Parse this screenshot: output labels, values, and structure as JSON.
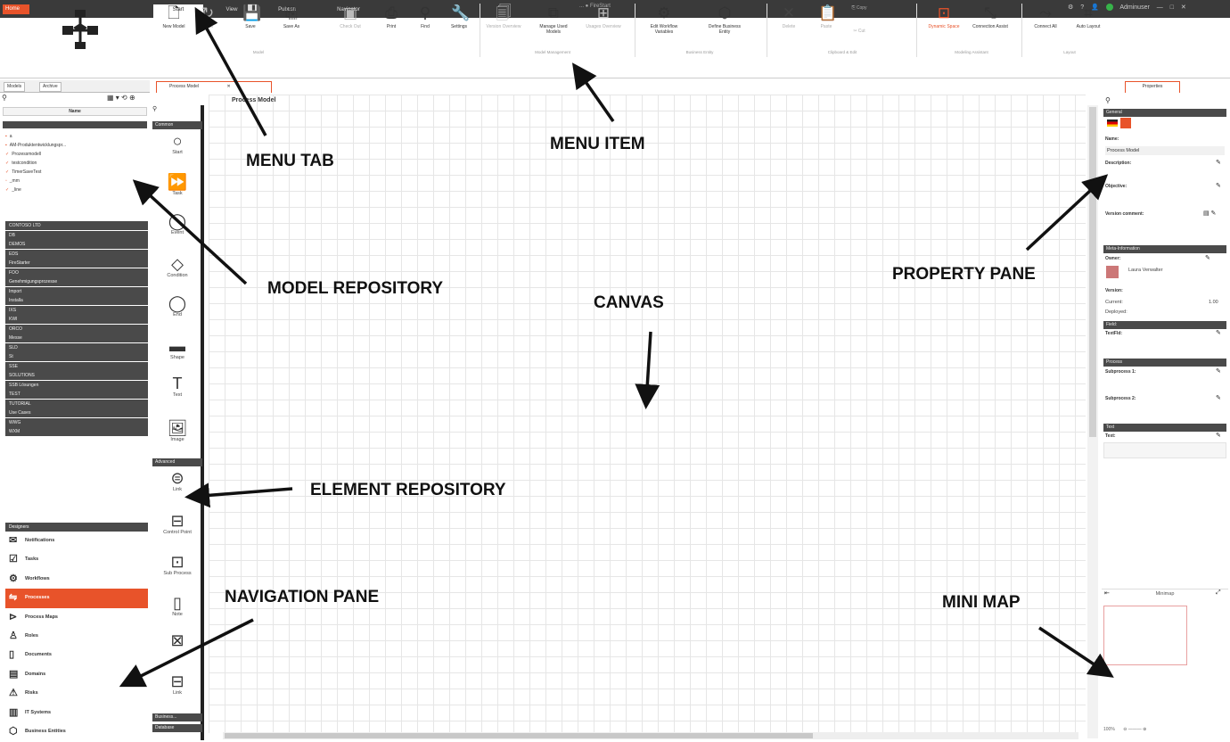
{
  "titlebar": {
    "app_button": "Home",
    "tabs": [
      "Start",
      "View",
      "Publish",
      "Navigator"
    ],
    "window_title": "... ● FireStart",
    "user": "Adminuser"
  },
  "ribbon": {
    "items": [
      {
        "label": "New Model",
        "icon": "new-document-icon"
      },
      {
        "label": "Redo",
        "icon": "redo-icon"
      },
      {
        "label": "Save",
        "icon": "save-icon"
      },
      {
        "label": "Save As",
        "icon": "save-as-icon"
      },
      {
        "label": "Check Out",
        "icon": "check-out-icon"
      },
      {
        "label": "Print",
        "icon": "print-icon"
      },
      {
        "label": "Find",
        "icon": "search-icon"
      },
      {
        "label": "Settings",
        "icon": "wrench-icon"
      },
      {
        "label": "Version Overview",
        "icon": "version-icon"
      },
      {
        "label": "Manage Used Models",
        "icon": "models-icon"
      },
      {
        "label": "Usages Overview",
        "icon": "usages-icon"
      },
      {
        "label": "Edit Workflow Variables",
        "icon": "variables-icon"
      },
      {
        "label": "Define Business Entity",
        "icon": "cube-icon"
      },
      {
        "label": "Delete",
        "icon": "delete-icon"
      },
      {
        "label": "Paste",
        "icon": "paste-icon"
      },
      {
        "label": "Copy",
        "icon": "copy-icon"
      },
      {
        "label": "Cut",
        "icon": "cut-icon"
      },
      {
        "label": "Dynamic Space",
        "icon": "dynamic-space-icon"
      },
      {
        "label": "Connection Assist",
        "icon": "connection-assist-icon"
      },
      {
        "label": "Connect All",
        "icon": "connect-all-icon"
      },
      {
        "label": "Auto Layout",
        "icon": "auto-layout-icon"
      }
    ],
    "groups": [
      "Model",
      "Model Management",
      "Business Entity",
      "Clipboard & Edit",
      "Modeling Assistant",
      "Layout"
    ]
  },
  "left_panel": {
    "tabs": [
      "Models",
      "Archive"
    ],
    "tree_header": "Name",
    "tree_items": [
      "a",
      "AM-Produktentwicklungspr...",
      "Prozessmodell",
      "testcondition",
      "TimerSaveTest",
      "_mm",
      "_line"
    ],
    "folders": [
      "CONTOSO LTD",
      "DB",
      "DEMOS",
      "EDS",
      "FireStarter",
      "FOO",
      "Genehmigungsprozesse",
      "Import",
      "Installa",
      "IXS",
      "KWI",
      "ORCO",
      "Messe",
      "SLD",
      "St",
      "SSE",
      "SOLUTIONS",
      "SSB Lösungen",
      "TEST",
      "TUTORIAL",
      "Use Cases",
      "WWG",
      "WXM"
    ]
  },
  "navigation": {
    "header": "Designers",
    "items": [
      {
        "label": "Notifications",
        "icon": "envelope-icon"
      },
      {
        "label": "Tasks",
        "icon": "task-icon"
      },
      {
        "label": "Workflows",
        "icon": "gear-icon"
      },
      {
        "label": "Processes",
        "icon": "process-icon"
      },
      {
        "label": "Process Maps",
        "icon": "process-map-icon"
      },
      {
        "label": "Roles",
        "icon": "role-icon"
      },
      {
        "label": "Documents",
        "icon": "document-icon"
      },
      {
        "label": "Domains",
        "icon": "domain-icon"
      },
      {
        "label": "Risks",
        "icon": "warning-icon"
      },
      {
        "label": "IT Systems",
        "icon": "server-icon"
      },
      {
        "label": "Business Entities",
        "icon": "cube-icon"
      }
    ],
    "active_index": 3
  },
  "elements": {
    "common_header": "Common",
    "common": [
      "Start",
      "Task",
      "Event",
      "Condition",
      "End",
      "Shape",
      "Text",
      "Image"
    ],
    "advanced_header": "Advanced",
    "advanced": [
      "Link",
      "Control Point",
      "Sub Process",
      "Note",
      "",
      "Link"
    ],
    "footer_sections": [
      "Business...",
      "Database"
    ]
  },
  "canvas": {
    "tab": "Process Model",
    "breadcrumb": "Process Model"
  },
  "properties": {
    "tab": "Properties",
    "general_header": "General",
    "name_label": "Name:",
    "name_value": "Process Model",
    "description_label": "Description:",
    "objective_label": "Objective:",
    "version_comment_label": "Version comment:",
    "meta_header": "Meta-Information",
    "owner_label": "Owner:",
    "owner_name": "Laura Verwalter",
    "version_label": "Version:",
    "current_label": "Current:",
    "current_value": "1.00",
    "deployed_label": "Deployed:",
    "section_label": "Field:",
    "textfield_label": "TextFld:",
    "process_header": "Process",
    "subprocess1_label": "Subprocess 1:",
    "subprocess2_label": "Subprocess 2:",
    "text_header": "Text",
    "text_label": "Text:"
  },
  "minimap": {
    "title": "Minimap",
    "zoom": "100%"
  },
  "annotations": {
    "menu_tab": "MENU TAB",
    "menu_item": "MENU ITEM",
    "model_repository": "MODEL REPOSITORY",
    "canvas": "CANVAS",
    "property_pane": "PROPERTY PANE",
    "element_repository": "ELEMENT REPOSITORY",
    "navigation_pane": "NAVIGATION PANE",
    "mini_map": "MINI MAP"
  },
  "colors": {
    "accent": "#e8532a",
    "dark_header": "#4a4a4a",
    "titlebar": "#3a3a3a",
    "status_green": "#37b34a"
  }
}
